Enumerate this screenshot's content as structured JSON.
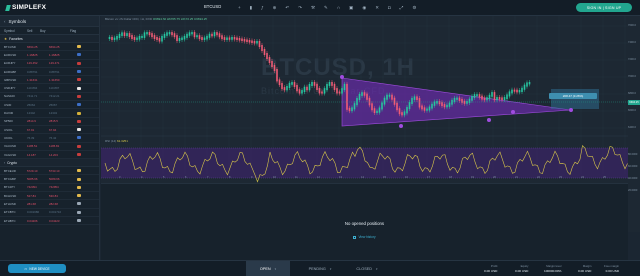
{
  "app": {
    "logo_text": "SIMPLEFX",
    "symbol": "BTCUSD",
    "signin_label": "SIGN IN  |  SIGN UP"
  },
  "toolbar": {
    "icons": [
      "crosshair-icon",
      "candles-icon",
      "indicators-icon",
      "compare-icon",
      "undo-icon",
      "redo-icon",
      "wrench-icon",
      "pencil-icon",
      "magnet-icon",
      "lock-icon",
      "eye-icon",
      "trash-icon",
      "camera-icon",
      "fullscreen-icon",
      "settings-icon"
    ]
  },
  "sidebar": {
    "title": "Symbols",
    "columns": {
      "symbol": "Symbol",
      "sell": "Sell",
      "buy": "Buy",
      "flag": "Flag"
    },
    "favorites_label": "Favorites",
    "favorites": [
      {
        "symbol": "BTCUSD",
        "sell": "6694.25",
        "buy": "6694.25",
        "color": "#e2506a",
        "flag": "#e2b94c"
      },
      {
        "symbol": "EURUSD",
        "sell": "1.16825",
        "buy": "1.16825",
        "color": "#e2506a",
        "flag": "#3d6fc7"
      },
      {
        "symbol": "EURJPY",
        "sell": "129.452",
        "buy": "129.471",
        "color": "#e2506a",
        "flag": "#c73d3d"
      },
      {
        "symbol": "EURGBP",
        "sell": "0.88791",
        "buy": "0.88791",
        "color": "#5b7386",
        "flag": "#3d6fc7"
      },
      {
        "symbol": "GBPUSD",
        "sell": "1.31631",
        "buy": "1.31650",
        "color": "#e2506a",
        "flag": "#c73d3d"
      },
      {
        "symbol": "USDJPY",
        "sell": "110.894",
        "buy": "110.897",
        "color": "#5b7386",
        "flag": "#e6e6e6"
      },
      {
        "symbol": "NAS100",
        "sell": "7411.71",
        "buy": "7412.21",
        "color": "#5b7386",
        "flag": "#c73d3d"
      },
      {
        "symbol": "US30",
        "sell": "25064",
        "buy": "25067",
        "color": "#5b7386",
        "flag": "#3d6fc7"
      },
      {
        "symbol": "DAX30",
        "sell": "12342",
        "buy": "12343",
        "color": "#5b7386",
        "flag": "#d4b13a"
      },
      {
        "symbol": "SP500",
        "sell": "2814.9",
        "buy": "2815.5",
        "color": "#e2506a",
        "flag": "#c73d3d"
      },
      {
        "symbol": "USOIL",
        "sell": "67.91",
        "buy": "67.94",
        "color": "#e2506a",
        "flag": "#e6e6e6"
      },
      {
        "symbol": "UKOIL",
        "sell": "76.39",
        "buy": "76.42",
        "color": "#5b7386",
        "flag": "#3d6fc7"
      },
      {
        "symbol": "XAUUSD",
        "sell": "1195.51",
        "buy": "1195.81",
        "color": "#e2506a",
        "flag": "#c73d3d"
      },
      {
        "symbol": "XAGUSD",
        "sell": "14.187",
        "buy": "14.203",
        "color": "#e2506a",
        "flag": "#c73d3d"
      }
    ],
    "crypto_label": "Crypto",
    "crypto": [
      {
        "symbol": "BTCEUR",
        "sell": "5729.10",
        "buy": "5733.10",
        "color": "#e2506a",
        "flag": "#e2b94c"
      },
      {
        "symbol": "BTCGBP",
        "sell": "5085.66",
        "buy": "5089.66",
        "color": "#e2506a",
        "flag": "#e2b94c"
      },
      {
        "symbol": "BTCJPY",
        "sell": "742394",
        "buy": "742954",
        "color": "#e2506a",
        "flag": "#e2b94c"
      },
      {
        "symbol": "BCHUSD",
        "sell": "527.84",
        "buy": "530.84",
        "color": "#e2506a",
        "flag": "#e2b94c"
      },
      {
        "symbol": "ETHUSD",
        "sell": "281.68",
        "buy": "282.68",
        "color": "#e2506a",
        "flag": "#9aa7b5"
      },
      {
        "symbol": "ETCBTC",
        "sell": "0.001680",
        "buy": "0.001710",
        "color": "#5b7386",
        "flag": "#9aa7b5"
      },
      {
        "symbol": "ETHBTC",
        "sell": "0.04206",
        "buy": "0.04223",
        "color": "#e2506a",
        "flag": "#9aa7b5"
      }
    ]
  },
  "chart": {
    "legend": "Bitcoin vs US Dollar CFD, 1H, DXD",
    "legend_vals": "O6694.50 H6705.75 L6672.25 C6694.25",
    "watermark": "BTCUSD, 1H",
    "watermark_sub": "Bitcoin vs US Dollar CFD",
    "measure_label": "208.47 (3.26%)",
    "price_tag": "6694.25",
    "right_axis": [
      "7600.0",
      "7400.0",
      "7200.0",
      "7000.0",
      "6800.0",
      "6600.0",
      "6400.0"
    ],
    "rsi_label": "RSI (14)",
    "rsi_value": "61.3251",
    "rsi_axis": [
      "80.0000",
      "60.0000",
      "40.0000",
      "20.0000"
    ],
    "x_labels": [
      "3",
      "4",
      "5",
      "6",
      "7",
      "8",
      "9",
      "10",
      "11",
      "12",
      "13",
      "14",
      "15",
      "16",
      "17",
      "18",
      "19",
      "20",
      "21",
      "22",
      "23",
      "24",
      "25"
    ],
    "chart_type": "candlestick",
    "up_color": "#26c6a0",
    "down_color": "#ef5b75",
    "pattern_color": "#7b2cc9"
  },
  "positions": {
    "empty_text": "No opened positions",
    "history_link": "View history"
  },
  "bottombar": {
    "new_device": "NEW DEVICE",
    "tabs": [
      {
        "label": "OPEN",
        "active": true
      },
      {
        "label": "PENDING",
        "active": false
      },
      {
        "label": "CLOSED",
        "active": false
      }
    ],
    "stats": [
      {
        "label": "Profit",
        "value": "0.00 USD"
      },
      {
        "label": "Equity",
        "value": "0.00 USD"
      },
      {
        "label": "Margin level",
        "value": "100000.00%"
      },
      {
        "label": "Margin",
        "value": "0.00 USD"
      },
      {
        "label": "Free margin",
        "value": "0.00 USD"
      }
    ]
  }
}
